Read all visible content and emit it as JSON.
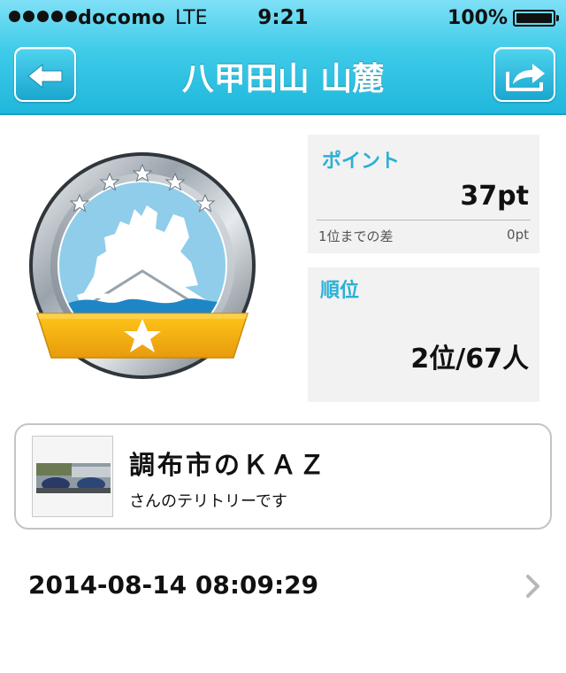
{
  "status_bar": {
    "carrier": "docomo",
    "network": "LTE",
    "time": "9:21",
    "battery": "100%"
  },
  "nav": {
    "title": "八甲田山 山麓",
    "back_icon": "back-arrow-icon",
    "share_icon": "share-icon"
  },
  "emblem": {
    "icon": "territory-badge-icon",
    "stars": 5
  },
  "points": {
    "label": "ポイント",
    "value": "37pt",
    "diff_label": "1位までの差",
    "diff_value": "0pt"
  },
  "rank": {
    "label": "順位",
    "value": "2位/67人"
  },
  "owner": {
    "name": "調布市のＫＡＺ",
    "subtitle": "さんのテリトリーです"
  },
  "history": {
    "datetime": "2014-08-14 08:09:29"
  },
  "colors": {
    "header": "#3ecbe8",
    "accent": "#2bb0d7",
    "ribbon": "#f2b21c",
    "panel": "#f2f2f2"
  }
}
